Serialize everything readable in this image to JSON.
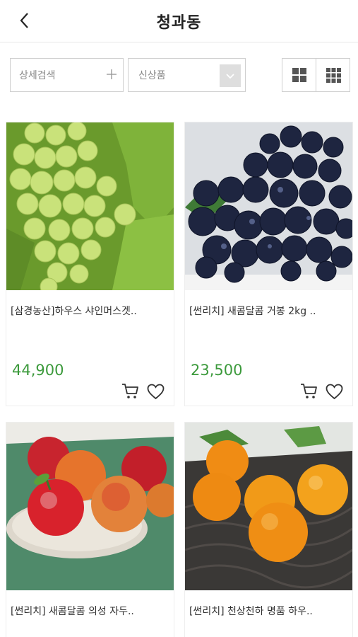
{
  "header": {
    "title": "청과동",
    "back_icon": "chevron-left-icon"
  },
  "toolbar": {
    "detail_search_label": "상세검색",
    "sort_label": "신상품",
    "view_options": [
      "grid-2-icon",
      "grid-3-icon"
    ]
  },
  "products": [
    {
      "name": "[삼경농산]하우스 샤인머스겟..",
      "price": "44,900",
      "fruit": "green-grapes"
    },
    {
      "name": "[썬리치] 새콤달콤 거봉 2kg ..",
      "price": "23,500",
      "fruit": "black-grapes"
    },
    {
      "name": "[썬리치] 새콤달콤 의성 자두..",
      "price": "",
      "fruit": "plums"
    },
    {
      "name": "[썬리치] 천상천하 명품 하우..",
      "price": "",
      "fruit": "tangerines"
    }
  ],
  "colors": {
    "price": "#3c9a3c",
    "border": "#cfcfcf"
  }
}
